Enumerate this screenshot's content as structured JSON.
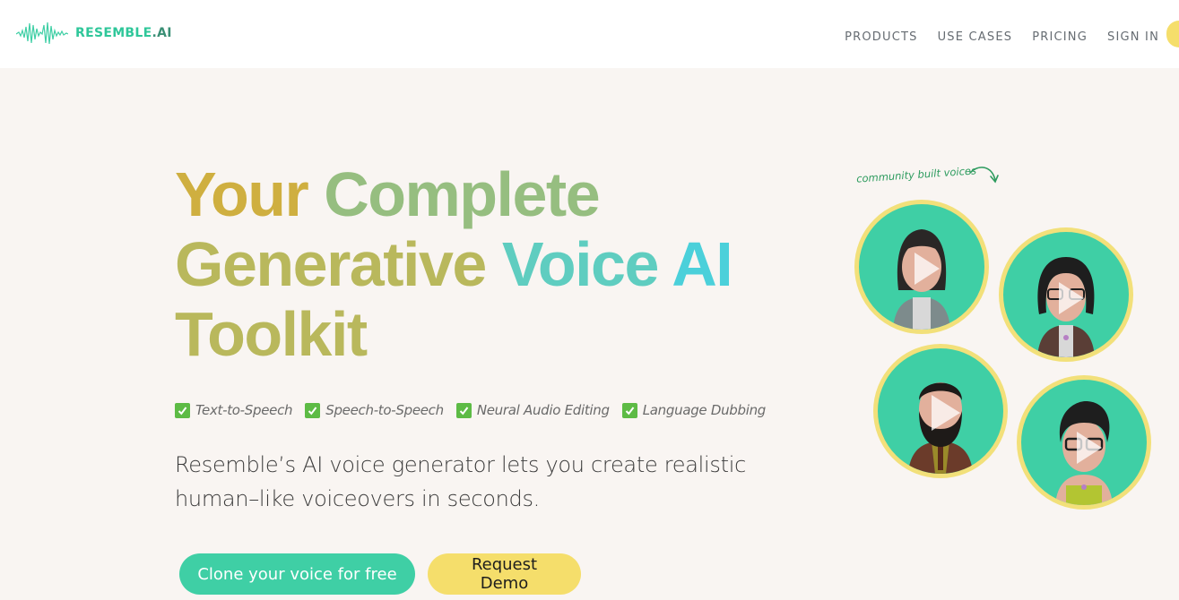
{
  "header": {
    "logo_text": "RESEMBLE",
    "logo_suffix": ".AI",
    "nav": [
      {
        "label": "PRODUCTS"
      },
      {
        "label": "USE CASES"
      },
      {
        "label": "PRICING"
      },
      {
        "label": "SIGN IN"
      }
    ]
  },
  "hero": {
    "title_words": [
      "Your",
      "Complete",
      "Generative",
      "Voice",
      "AI",
      "Toolkit"
    ],
    "features": [
      {
        "icon": "checkbox-checked-icon",
        "label": "Text-to-Speech"
      },
      {
        "icon": "checkbox-checked-icon",
        "label": "Speech-to-Speech"
      },
      {
        "icon": "checkbox-checked-icon",
        "label": "Neural Audio Editing"
      },
      {
        "icon": "checkbox-checked-icon",
        "label": "Language Dubbing"
      }
    ],
    "subtitle": "Resemble’s AI voice generator lets you create realistic human–like voiceovers in seconds.",
    "primary_button": "Clone your voice for free",
    "secondary_button": "Request Demo"
  },
  "community": {
    "label": "community built voices",
    "voices": [
      {
        "name": "voice-avatar-1",
        "icon": "play-icon"
      },
      {
        "name": "voice-avatar-2",
        "icon": "play-icon"
      },
      {
        "name": "voice-avatar-3",
        "icon": "play-icon"
      },
      {
        "name": "voice-avatar-4",
        "icon": "play-icon"
      }
    ]
  },
  "colors": {
    "brand_green": "#3fcfa5",
    "brand_yellow": "#f5de6b",
    "background": "#f9f5f2",
    "check_green": "#5dbb45"
  }
}
